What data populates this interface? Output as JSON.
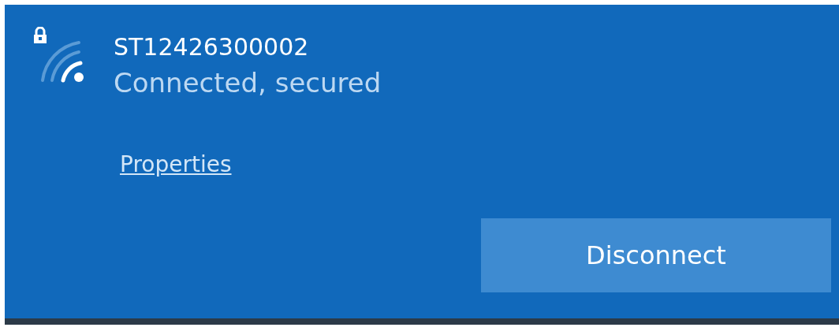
{
  "network": {
    "name": "ST12426300002",
    "status": "Connected, secured",
    "secured": true
  },
  "properties_link": "Properties",
  "buttons": [
    {
      "label": "Disconnect"
    }
  ]
}
